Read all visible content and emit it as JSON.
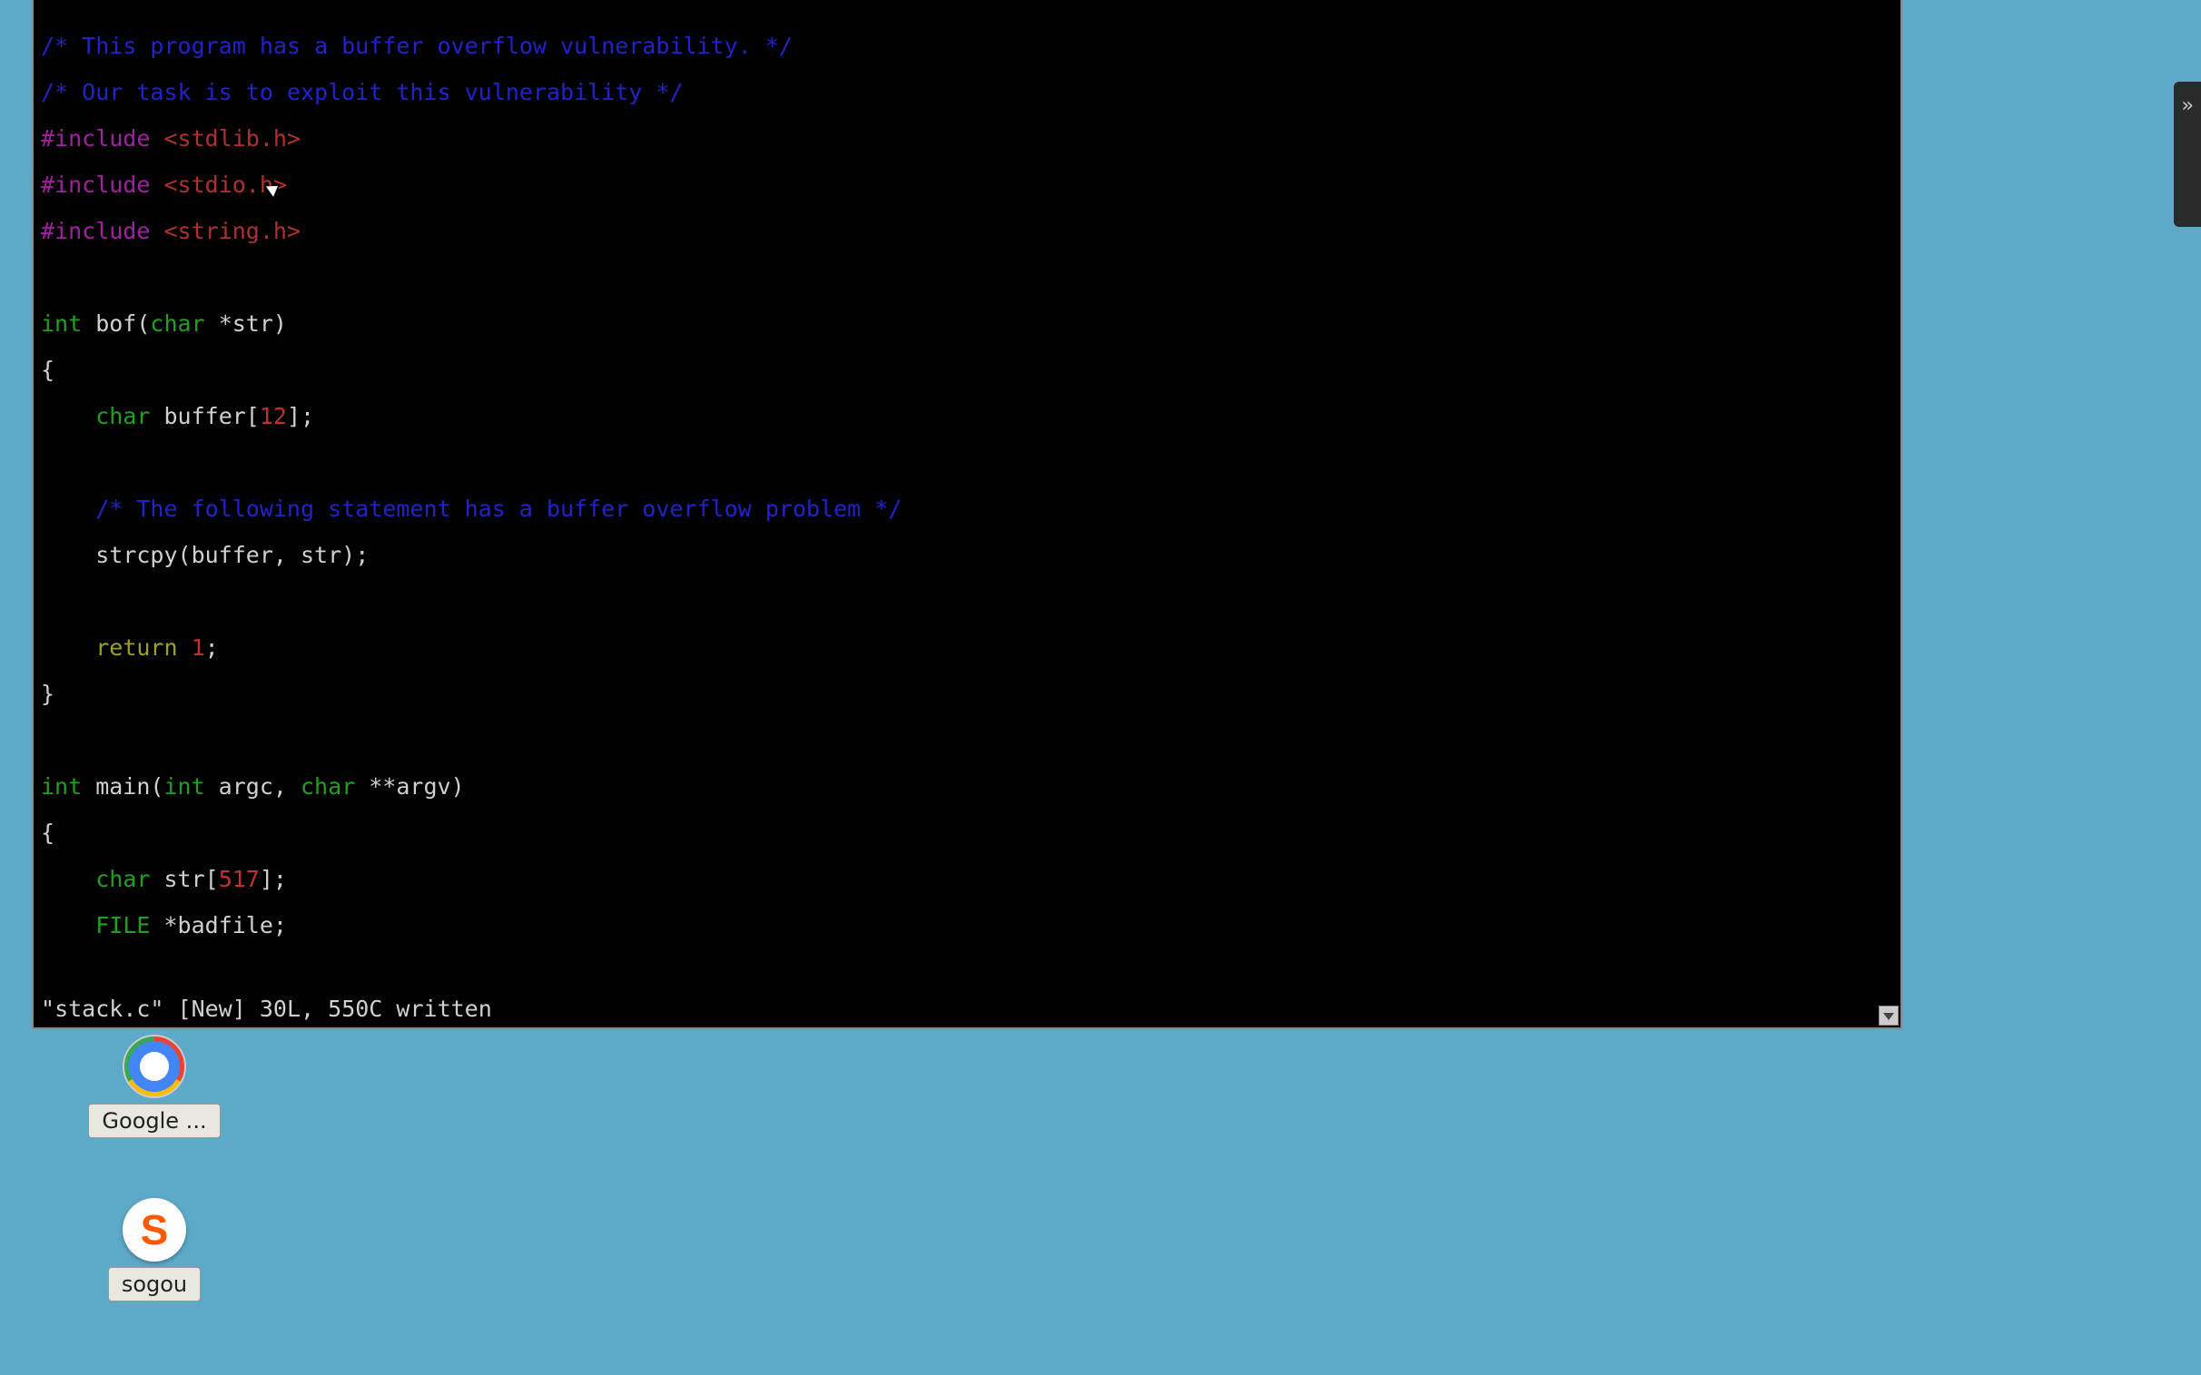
{
  "editor": {
    "filename": "stack.c",
    "status_flag": "[New]",
    "lines_count": "30L,",
    "chars_count": "550C",
    "status_verb": "written",
    "code": {
      "comment1": "/* This program has a buffer overflow vulnerability. */",
      "comment2": "/* Our task is to exploit this vulnerability */",
      "include_kw": "#include",
      "hdr1": "<stdlib.h>",
      "hdr2": "<stdio.h>",
      "hdr3": "<string.h>",
      "int_kw": "int",
      "char_kw": "char",
      "file_kw": "FILE",
      "return_kw": "return",
      "bof_sig_mid": " bof(",
      "bof_sig_end": " *str)",
      "open_brace": "{",
      "close_brace": "}",
      "buffer_decl_pre": " buffer[",
      "buffer_decl_num": "12",
      "buffer_decl_post": "];",
      "strcpy_comment": "/* The following statement has a buffer overflow problem */",
      "strcpy_line": "strcpy(buffer, str);",
      "return_num": "1",
      "return_post": ";",
      "main_sig_mid": " main(",
      "main_sig_mid2": " argc, ",
      "main_sig_end": " **argv)",
      "str_decl_pre": " str[",
      "str_decl_num": "517",
      "str_decl_post": "];",
      "badfile_decl": " *badfile;"
    }
  },
  "desktop": {
    "chrome_label": "Google ...",
    "sogou_label": "sogou",
    "sogou_glyph": "S"
  },
  "side_tab_glyph": "»"
}
